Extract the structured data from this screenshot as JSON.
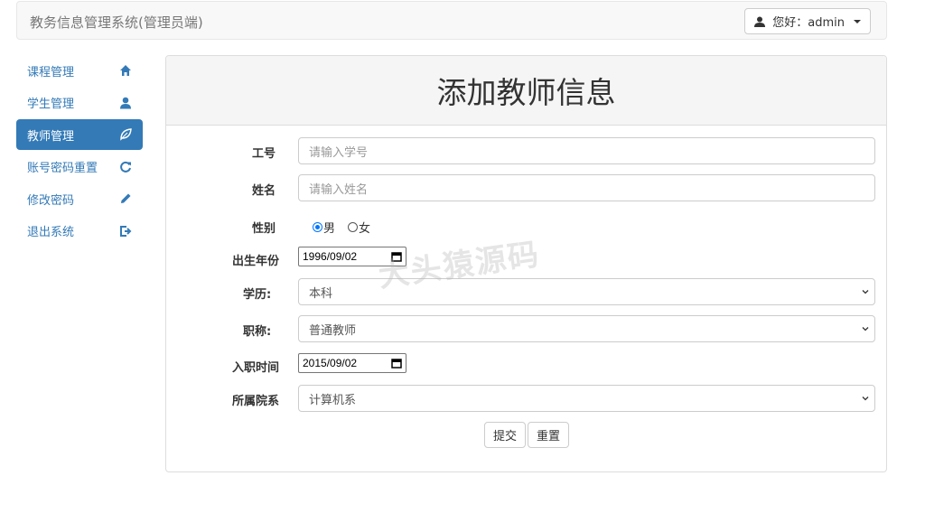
{
  "header": {
    "brand": "教务信息管理系统(管理员端)",
    "user_label": "您好：admin"
  },
  "sidebar": {
    "items": [
      {
        "label": "课程管理",
        "icon": "home-icon",
        "active": false
      },
      {
        "label": "学生管理",
        "icon": "user-icon",
        "active": false
      },
      {
        "label": "教师管理",
        "icon": "leaf-icon",
        "active": true
      },
      {
        "label": "账号密码重置",
        "icon": "refresh-icon",
        "active": false
      },
      {
        "label": "修改密码",
        "icon": "pencil-icon",
        "active": false
      },
      {
        "label": "退出系统",
        "icon": "logout-icon",
        "active": false
      }
    ]
  },
  "form": {
    "title": "添加教师信息",
    "fields": {
      "id": {
        "label": "工号",
        "placeholder": "请输入学号"
      },
      "name": {
        "label": "姓名",
        "placeholder": "请输入姓名"
      },
      "gender": {
        "label": "性别",
        "options": [
          "男",
          "女"
        ],
        "selected": "男"
      },
      "birth": {
        "label": "出生年份",
        "value": "1996/09/02"
      },
      "education": {
        "label": "学历:",
        "value": "本科"
      },
      "title": {
        "label": "职称:",
        "value": "普通教师"
      },
      "hire_date": {
        "label": "入职时间",
        "value": "2015/09/02"
      },
      "department": {
        "label": "所属院系",
        "value": "计算机系"
      }
    },
    "submit_label": "提交",
    "reset_label": "重置"
  },
  "watermark": "大头猿源码",
  "colors": {
    "accent": "#337ab7",
    "radio": "#0075ff"
  }
}
